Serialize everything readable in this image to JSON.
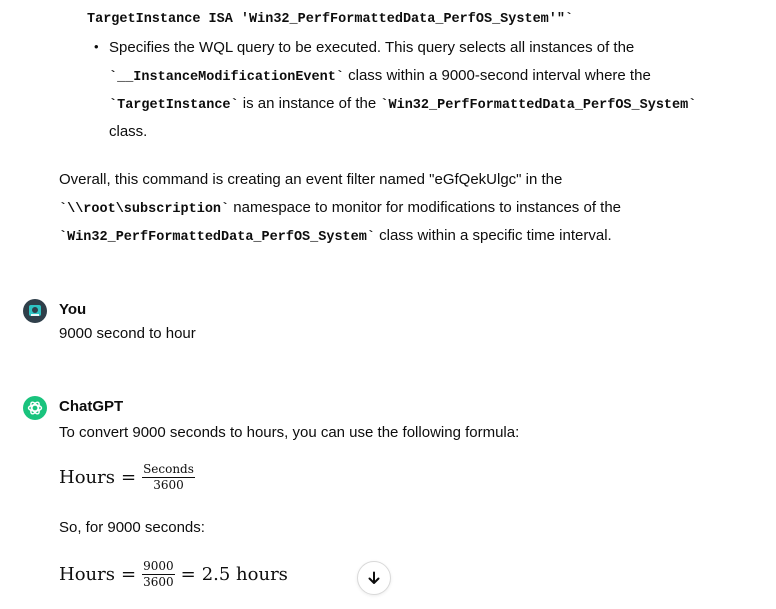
{
  "code_snippet": {
    "line_start": "TargetInstance ISA 'Win32_PerfFormattedData_PerfOS_System'\"`"
  },
  "bullet": {
    "l1": "Specifies the WQL query to be executed. This query selects all instances of the",
    "l2_code": "`__InstanceModificationEvent`",
    "l2_text": " class within a 9000-second interval where the",
    "l3_code1": "`TargetInstance`",
    "l3_text": " is an instance of the ",
    "l3_code2": "`Win32_PerfFormattedData_PerfOS_System`",
    "l4": "class."
  },
  "overall": {
    "l1": "Overall, this command is creating an event filter named \"eGfQekUlgc\" in the",
    "l2_code": "`\\\\root\\subscription`",
    "l2_text": " namespace to monitor for modifications to instances of the",
    "l3_code": "`Win32_PerfFormattedData_PerfOS_System`",
    "l3_text": " class within a specific time interval."
  },
  "user_message": {
    "speaker": "You",
    "text": "9000 second to hour"
  },
  "assistant_message": {
    "speaker": "ChatGPT",
    "intro": "To convert 9000 seconds to hours, you can use the following formula:",
    "formula1": {
      "lhs": "Hours",
      "eq": "=",
      "numerator": "Seconds",
      "denominator": "3600"
    },
    "so_text": "So, for 9000 seconds:",
    "formula2": {
      "lhs": "Hours",
      "eq": "=",
      "numerator": "9000",
      "denominator": "3600",
      "eq2": "=",
      "result": "2.5 hours"
    }
  },
  "colors": {
    "chatgpt_avatar": "#19c37d",
    "user_avatar": "#2f3f4a",
    "user_avatar_inner": "#2ec4c4"
  },
  "icons": {
    "scroll_down": "arrow-down-icon",
    "user_avatar": "user-avatar-icon",
    "chatgpt_avatar": "openai-logo-icon"
  }
}
